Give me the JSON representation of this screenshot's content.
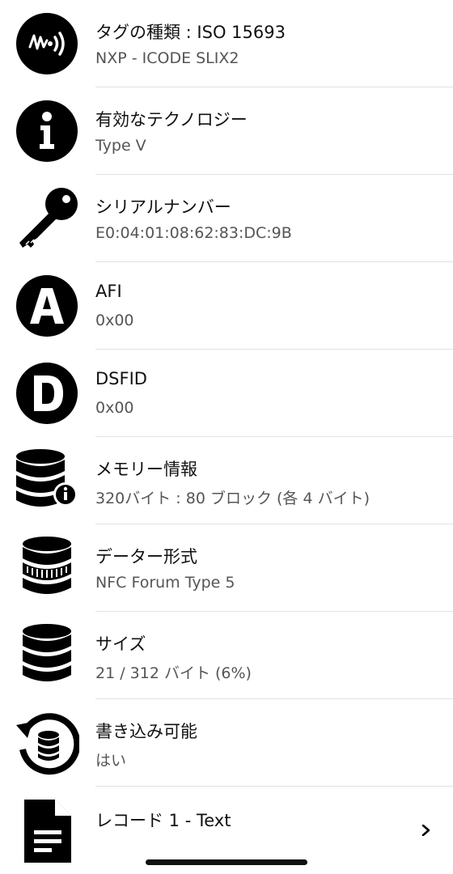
{
  "rows": [
    {
      "title": "タグの種類 : ISO 15693",
      "value": "NXP - ICODE SLIX2",
      "icon": "nfc-tag-icon"
    },
    {
      "title": "有効なテクノロジー",
      "value": "Type V",
      "icon": "info-icon"
    },
    {
      "title": "シリアルナンバー",
      "value": "E0:04:01:08:62:83:DC:9B",
      "icon": "key-icon"
    },
    {
      "title": "AFI",
      "value": "0x00",
      "icon": "letter-a-icon"
    },
    {
      "title": "DSFID",
      "value": "0x00",
      "icon": "letter-d-icon"
    },
    {
      "title": "メモリー情報",
      "value": "320バイト : 80 ブロック (各 4 バイト)",
      "icon": "database-info-icon"
    },
    {
      "title": "データー形式",
      "value": "NFC Forum Type 5",
      "icon": "database-format-icon"
    },
    {
      "title": "サイズ",
      "value": "21 / 312 バイト (6%)",
      "icon": "database-icon"
    },
    {
      "title": "書き込み可能",
      "value": "はい",
      "icon": "database-refresh-icon"
    },
    {
      "title": "レコード 1 - Text",
      "icon": "document-icon",
      "chevron": "chevron-right-icon"
    }
  ]
}
